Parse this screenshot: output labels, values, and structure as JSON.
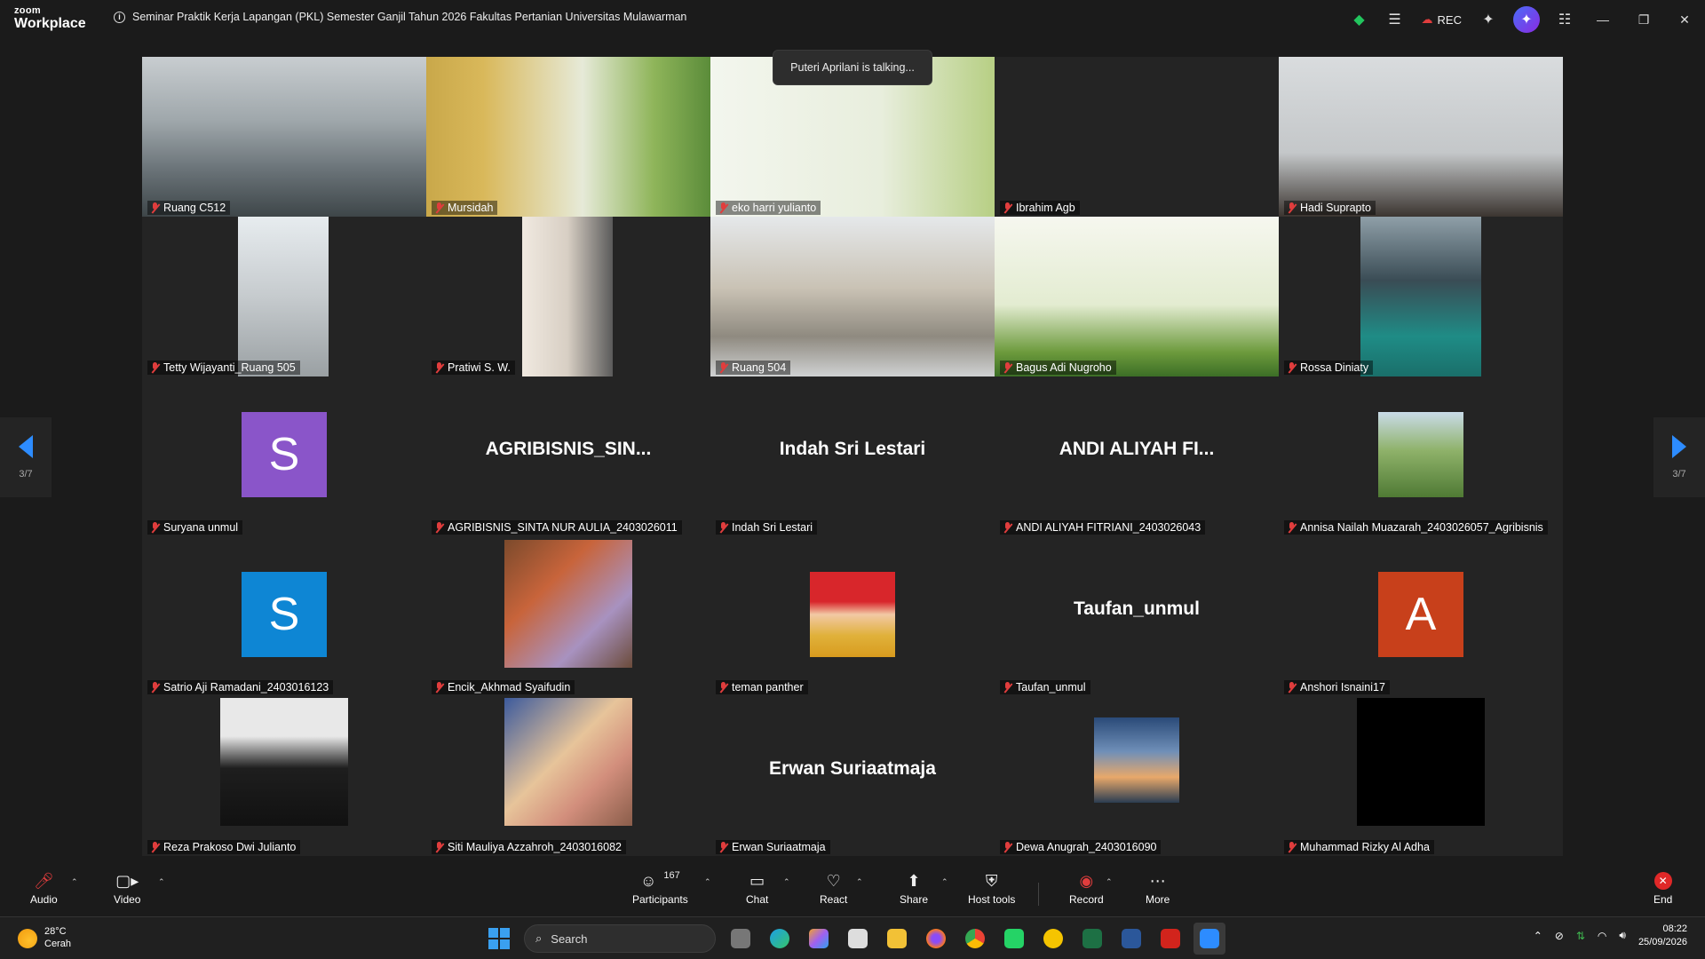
{
  "app": {
    "brand_small": "zoom",
    "brand_large": "Workplace"
  },
  "meeting": {
    "title": "Seminar Praktik Kerja Lapangan (PKL) Semester Ganjil Tahun 2026 Fakultas Pertanian Universitas Mulawarman"
  },
  "topbar": {
    "rec_label": "REC"
  },
  "talking_indicator": "Puteri Aprilani is talking...",
  "pager": {
    "left_page": "3/7",
    "right_page": "3/7"
  },
  "tiles": [
    {
      "name": "Ruang C512"
    },
    {
      "name": "Mursidah"
    },
    {
      "name": "eko harri yulianto"
    },
    {
      "name": "Ibrahim Agb"
    },
    {
      "name": "Hadi Suprapto"
    },
    {
      "name": "Tetty Wijayanti_Ruang 505"
    },
    {
      "name": "Pratiwi S. W."
    },
    {
      "name": "Ruang 504"
    },
    {
      "name": "Bagus Adi Nugroho"
    },
    {
      "name": "Rossa Diniaty"
    },
    {
      "name": "Suryana unmul",
      "avatar_letter": "S",
      "avatar_color": "#8a55c9"
    },
    {
      "name": "AGRIBISNIS_SINTA NUR AULIA_2403026011",
      "display": "AGRIBISNIS_SIN..."
    },
    {
      "name": "Indah Sri Lestari",
      "display": "Indah Sri Lestari"
    },
    {
      "name": "ANDI ALIYAH FITRIANI_2403026043",
      "display": "ANDI  ALIYAH  FI..."
    },
    {
      "name": "Annisa Nailah Muazarah_2403026057_Agribisnis"
    },
    {
      "name": "Satrio Aji Ramadani_2403016123",
      "avatar_letter": "S",
      "avatar_color": "#0e86d4"
    },
    {
      "name": "Encik_Akhmad Syaifudin"
    },
    {
      "name": "teman panther"
    },
    {
      "name": "Taufan_unmul",
      "display": "Taufan_unmul"
    },
    {
      "name": "Anshori Isnaini17",
      "avatar_letter": "A",
      "avatar_color": "#c8401b"
    },
    {
      "name": "Reza Prakoso Dwi Julianto"
    },
    {
      "name": "Siti Mauliya Azzahroh_2403016082"
    },
    {
      "name": "Erwan Suriaatmaja",
      "display": "Erwan Suriaatmaja"
    },
    {
      "name": "Dewa Anugrah_2403016090"
    },
    {
      "name": "Muhammad Rizky Al Adha"
    }
  ],
  "toolbar": {
    "audio": "Audio",
    "video": "Video",
    "participants": "Participants",
    "participants_count": "167",
    "chat": "Chat",
    "react": "React",
    "share": "Share",
    "host_tools": "Host tools",
    "record": "Record",
    "more": "More",
    "end": "End"
  },
  "taskbar": {
    "temp": "28°C",
    "condition": "Cerah",
    "search_placeholder": "Search",
    "time": "08:22",
    "date": "25/09/2026"
  },
  "colors": {
    "accent": "#0e72ed",
    "mute": "#e03d3d",
    "end": "#e02828"
  }
}
